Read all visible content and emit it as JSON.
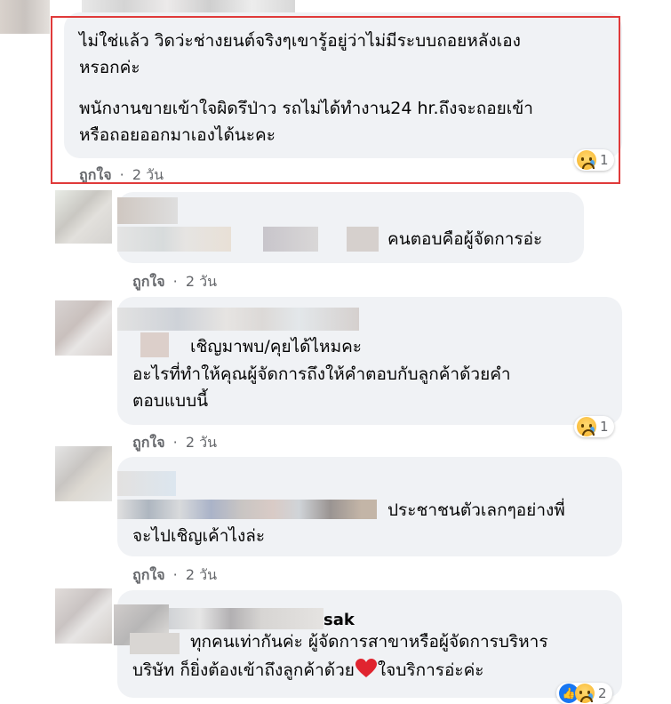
{
  "comments": [
    {
      "lines": [
        "ไม่ใช่แล้ว วิดว่ะช่างยนต์จริงๆเขารู้อยู่ว่าไม่มีระบบถอยหลังเอง",
        "หรอกค่ะ",
        "พนักงานขายเข้าใจผิดรึป่าว รถไม่ได้ทำงาน24 hr.ถึงจะถอยเข้า",
        "หรือถอยออกมาเองได้นะคะ"
      ],
      "like_label": "ถูกใจ",
      "time": "2 วัน",
      "reaction_count": "1"
    },
    {
      "lines": [
        "คนตอบคือผู้จัดการอ่ะ"
      ],
      "like_label": "ถูกใจ",
      "time": "2 วัน"
    },
    {
      "lines": [
        "เชิญมาพบ/คุยได้ไหมคะ",
        "อะไรที่ทำให้คุณผู้จัดการถึงให้คำตอบกับลูกค้าด้วยคำ",
        "ตอบแบบนี้"
      ],
      "like_label": "ถูกใจ",
      "time": "2 วัน",
      "reaction_count": "1"
    },
    {
      "lines": [
        "ประชาชนตัวเลกๆอย่างพี่",
        "จะไปเชิญเค้าไงล่ะ"
      ],
      "like_label": "ถูกใจ",
      "time": "2 วัน"
    },
    {
      "author_fragment": "sak",
      "lines": [
        "ทุกคนเท่ากันค่ะ ผู้จัดการสาขาหรือผู้จัดการบริหาร",
        "บริษัท ก็ยิ่งต้องเข้าถึงลูกค้าด้วย",
        "ใจบริการอ่ะค่ะ"
      ],
      "reaction_count": "2"
    }
  ],
  "separator": "·",
  "colors": {
    "highlight_border": "#e03a3a",
    "bubble": "#f0f2f5",
    "meta": "#65676b"
  }
}
